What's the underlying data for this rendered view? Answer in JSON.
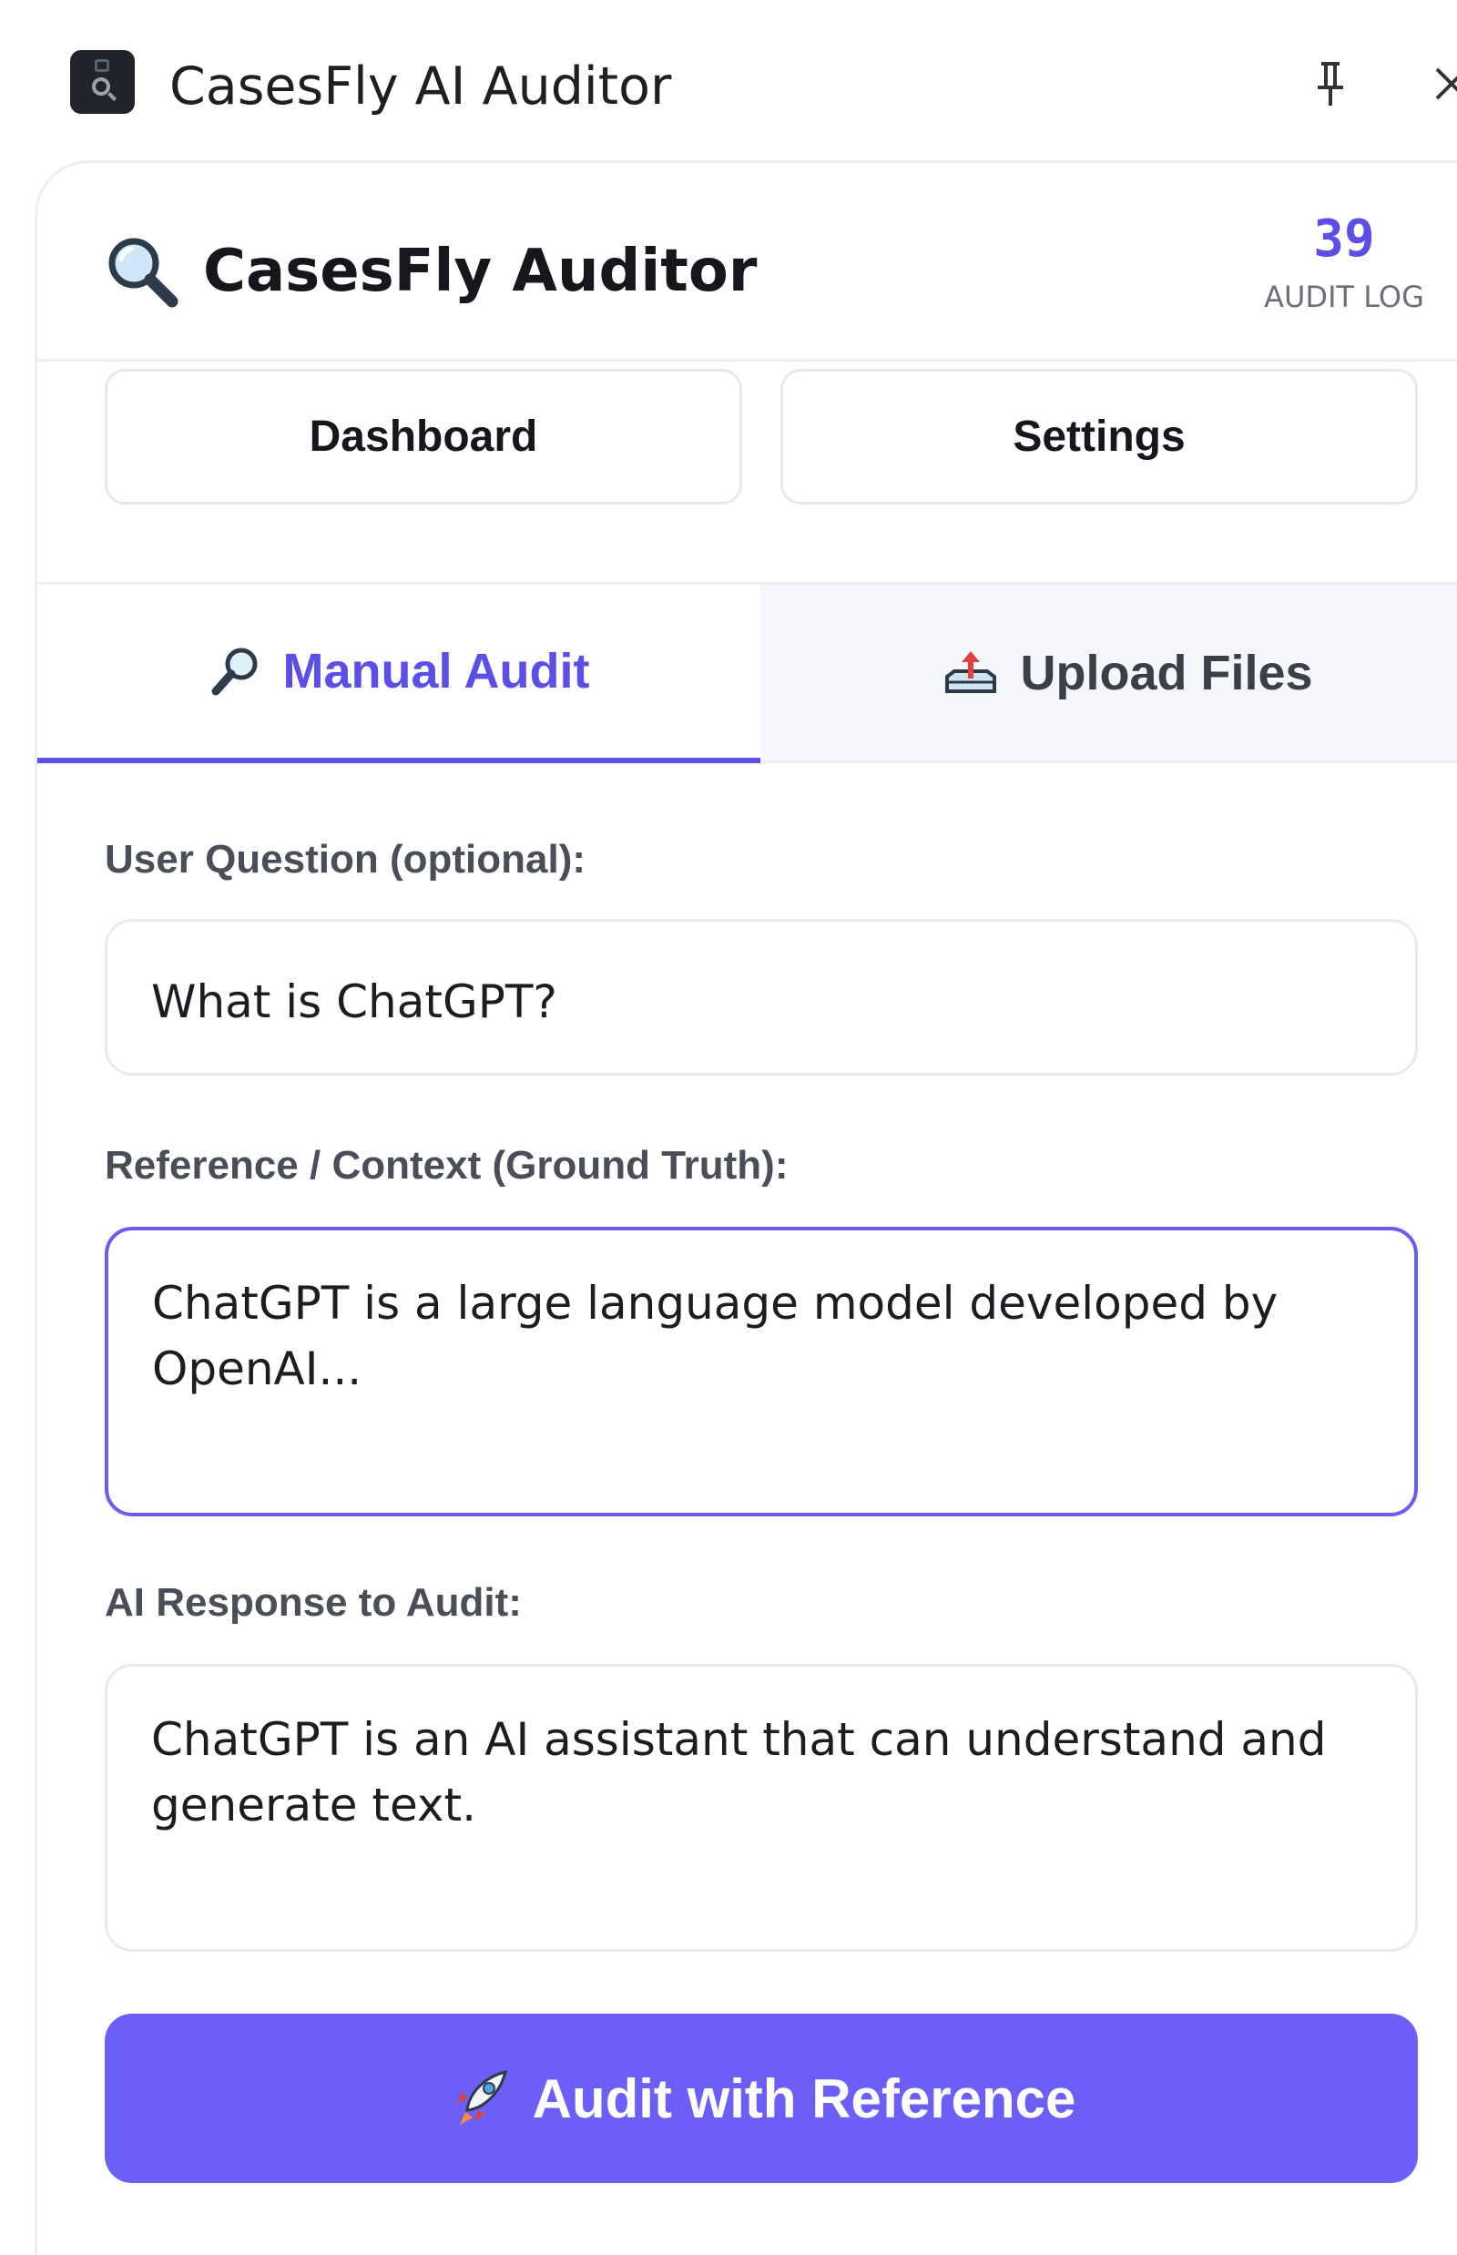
{
  "window": {
    "title": "CasesFly AI Auditor",
    "pin_icon": "pin-icon",
    "close_icon": "close-icon"
  },
  "header": {
    "brand_icon": "magnifier-icon",
    "brand_name": "CasesFly Auditor",
    "audit_count": "39",
    "audit_label": "AUDIT LOG"
  },
  "nav": {
    "dashboard_label": "Dashboard",
    "settings_label": "Settings"
  },
  "tabs": [
    {
      "label": "Manual Audit",
      "icon": "magnifier-icon",
      "active": true
    },
    {
      "label": "Upload Files",
      "icon": "upload-tray-icon",
      "active": false
    }
  ],
  "form": {
    "question_label": "User Question (optional):",
    "question_value": "What is ChatGPT?",
    "reference_label": "Reference / Context (Ground Truth):",
    "reference_value": "ChatGPT is a large language model developed by\nOpenAI...",
    "response_label": "AI Response to Audit:",
    "response_value": "ChatGPT is an AI assistant that can understand and\ngenerate text.",
    "submit_label": "Audit with Reference",
    "submit_icon": "rocket-icon"
  },
  "colors": {
    "accent": "#5b4fe8",
    "button": "#6b5ff8",
    "border": "#e9eaf0"
  }
}
